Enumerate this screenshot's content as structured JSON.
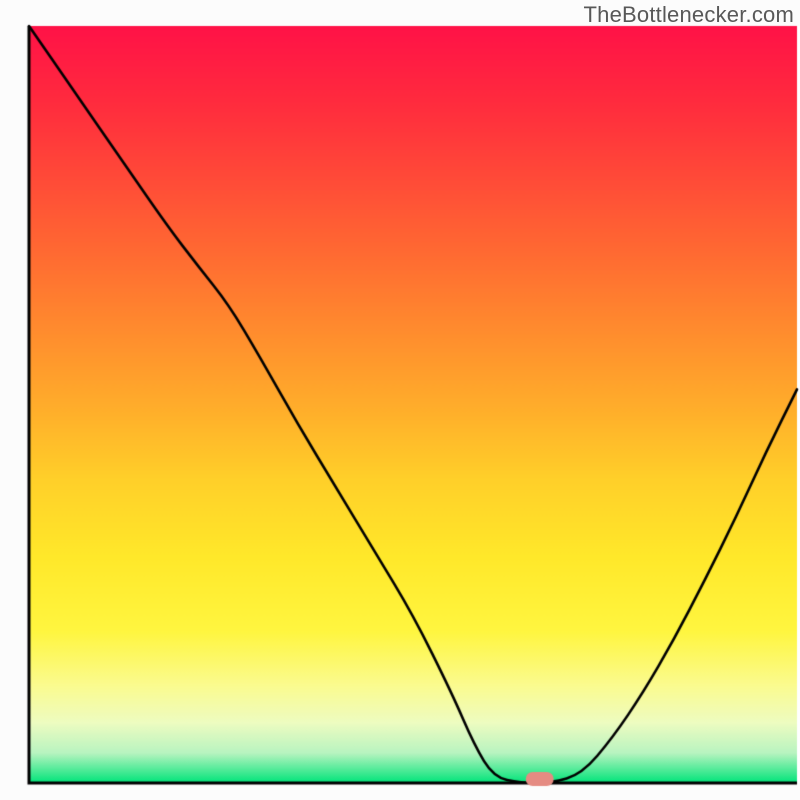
{
  "attribution": "TheBottlenecker.com",
  "chart_data": {
    "type": "line",
    "title": "",
    "xlabel": "",
    "ylabel": "",
    "xlim": [
      0,
      1
    ],
    "ylim": [
      0,
      1
    ],
    "axes": {
      "left": true,
      "bottom": true,
      "top": false,
      "right": false,
      "tick_labels": false,
      "grid": false
    },
    "background_gradient": {
      "stops": [
        [
          0.0,
          "#ff1247"
        ],
        [
          0.1,
          "#ff2b3e"
        ],
        [
          0.2,
          "#ff4a38"
        ],
        [
          0.3,
          "#ff6a32"
        ],
        [
          0.4,
          "#ff8b2e"
        ],
        [
          0.5,
          "#ffac2b"
        ],
        [
          0.6,
          "#ffd029"
        ],
        [
          0.7,
          "#ffe82a"
        ],
        [
          0.8,
          "#fff640"
        ],
        [
          0.87,
          "#fbfb8e"
        ],
        [
          0.92,
          "#eefcc0"
        ],
        [
          0.96,
          "#b9f4c0"
        ],
        [
          1.0,
          "#00e47a"
        ]
      ]
    },
    "curve": {
      "x": [
        0.0,
        0.06,
        0.12,
        0.18,
        0.22,
        0.26,
        0.3,
        0.35,
        0.4,
        0.45,
        0.5,
        0.55,
        0.58,
        0.605,
        0.64,
        0.68,
        0.72,
        0.76,
        0.8,
        0.84,
        0.88,
        0.92,
        0.96,
        1.0
      ],
      "y": [
        1.0,
        0.912,
        0.824,
        0.736,
        0.683,
        0.632,
        0.564,
        0.474,
        0.39,
        0.306,
        0.222,
        0.12,
        0.05,
        0.008,
        0.0,
        0.0,
        0.012,
        0.06,
        0.12,
        0.19,
        0.268,
        0.35,
        0.438,
        0.52
      ]
    },
    "marker": {
      "x": 0.665,
      "y": 0.0,
      "shape": "capsule",
      "color": "#e58b82"
    }
  }
}
